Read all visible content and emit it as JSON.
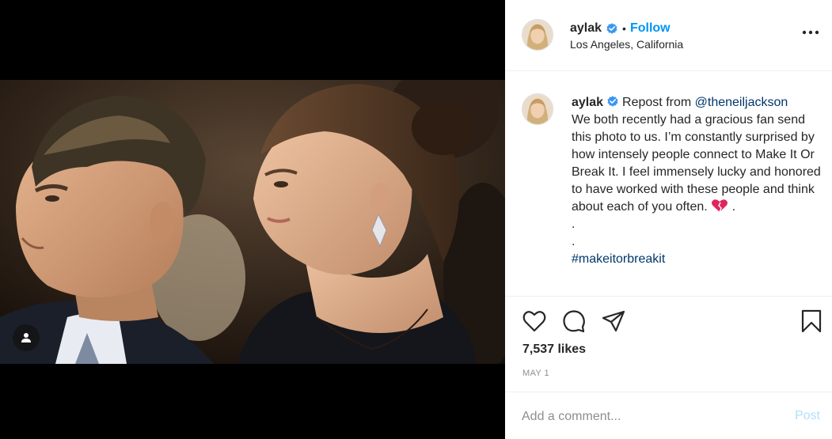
{
  "post": {
    "username": "aylak",
    "verified": true,
    "follow_separator": "•",
    "follow_label": "Follow",
    "location": "Los Angeles, California",
    "more_icon": "more-options-icon"
  },
  "caption": {
    "username": "aylak",
    "repost_prefix": "Repost from ",
    "mention": "@theneiljackson",
    "body": "We both recently had a gracious fan send this photo to us. I’m constantly surprised by how intensely people connect to Make It Or Break It. I feel immensely lucky and honored to have worked with these people and think about each of you often. ",
    "emoji": "heart-emoji",
    "trail": " .",
    "dots": [
      ".",
      "."
    ],
    "hashtag": "#makeitorbreakit"
  },
  "actions": {
    "icons": [
      "heart-icon",
      "comment-icon",
      "share-icon",
      "bookmark-icon"
    ],
    "likes": "7,537 likes",
    "date": "MAY 1"
  },
  "comment": {
    "placeholder": "Add a comment...",
    "post_label": "Post"
  },
  "colors": {
    "link": "#0095f6",
    "mention": "#00376b",
    "verified": "#3897f0",
    "post_disabled": "#b2dffc",
    "emoji": "#e0245e"
  }
}
